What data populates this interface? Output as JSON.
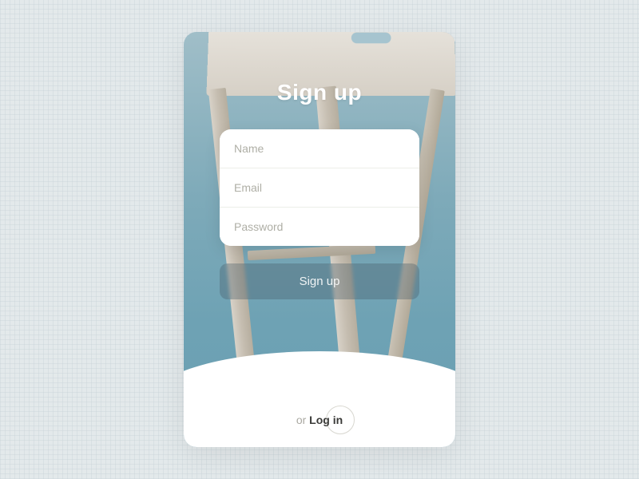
{
  "header": {
    "title": "Sign up"
  },
  "form": {
    "fields": [
      {
        "placeholder": "Name"
      },
      {
        "placeholder": "Email"
      },
      {
        "placeholder": "Password"
      }
    ],
    "submit_label": "Sign up"
  },
  "footer": {
    "or_text": "or ",
    "login_label": "Log in"
  }
}
